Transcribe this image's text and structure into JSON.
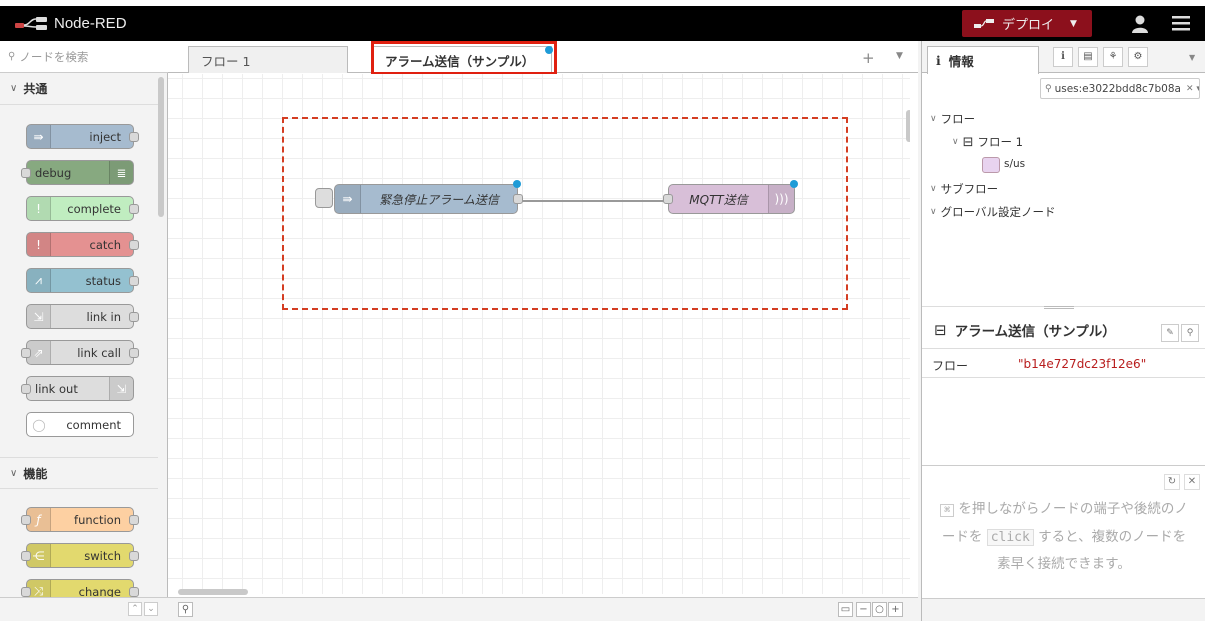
{
  "app": {
    "title": "Node-RED"
  },
  "header": {
    "deploy_label": "デプロイ"
  },
  "palette": {
    "search_placeholder": "ノードを検索",
    "categories": [
      {
        "label": "共通",
        "nodes": [
          "inject",
          "debug",
          "complete",
          "catch",
          "status",
          "link in",
          "link call",
          "link out",
          "comment"
        ]
      },
      {
        "label": "機能",
        "nodes": [
          "function",
          "switch",
          "change"
        ]
      }
    ]
  },
  "workspace": {
    "tabs": [
      {
        "label": "フロー 1"
      },
      {
        "label": "アラーム送信（サンプル）"
      }
    ],
    "nodes": [
      {
        "label": "緊急停止アラーム送信",
        "type": "inject",
        "color": "#a6bbcf"
      },
      {
        "label": "MQTT送信",
        "type": "mqtt out",
        "color": "#d8bfd8"
      }
    ]
  },
  "sidebar": {
    "tab_label": "情報",
    "search_value": "uses:e3022bdd8c7b08a",
    "tree": {
      "flows_label": "フロー",
      "flow1": "フロー 1",
      "flow1_child": "s/us",
      "subflows_label": "サブフロー",
      "global_label": "グローバル設定ノード"
    },
    "selected_flow_title": "アラーム送信（サンプル）",
    "prop_key": "フロー",
    "prop_value": "\"b14e727dc23f12e6\"",
    "tip_part1": "を押しながらノードの端子や後続のノードを",
    "tip_code": "click",
    "tip_part2": "すると、複数のノードを素早く接続できます。"
  },
  "colors": {
    "header_bg": "#000000",
    "deploy_bg": "#8c101c",
    "highlight": "#e02010",
    "group_border": "#d43d22",
    "changed": "#1e9bd7"
  }
}
